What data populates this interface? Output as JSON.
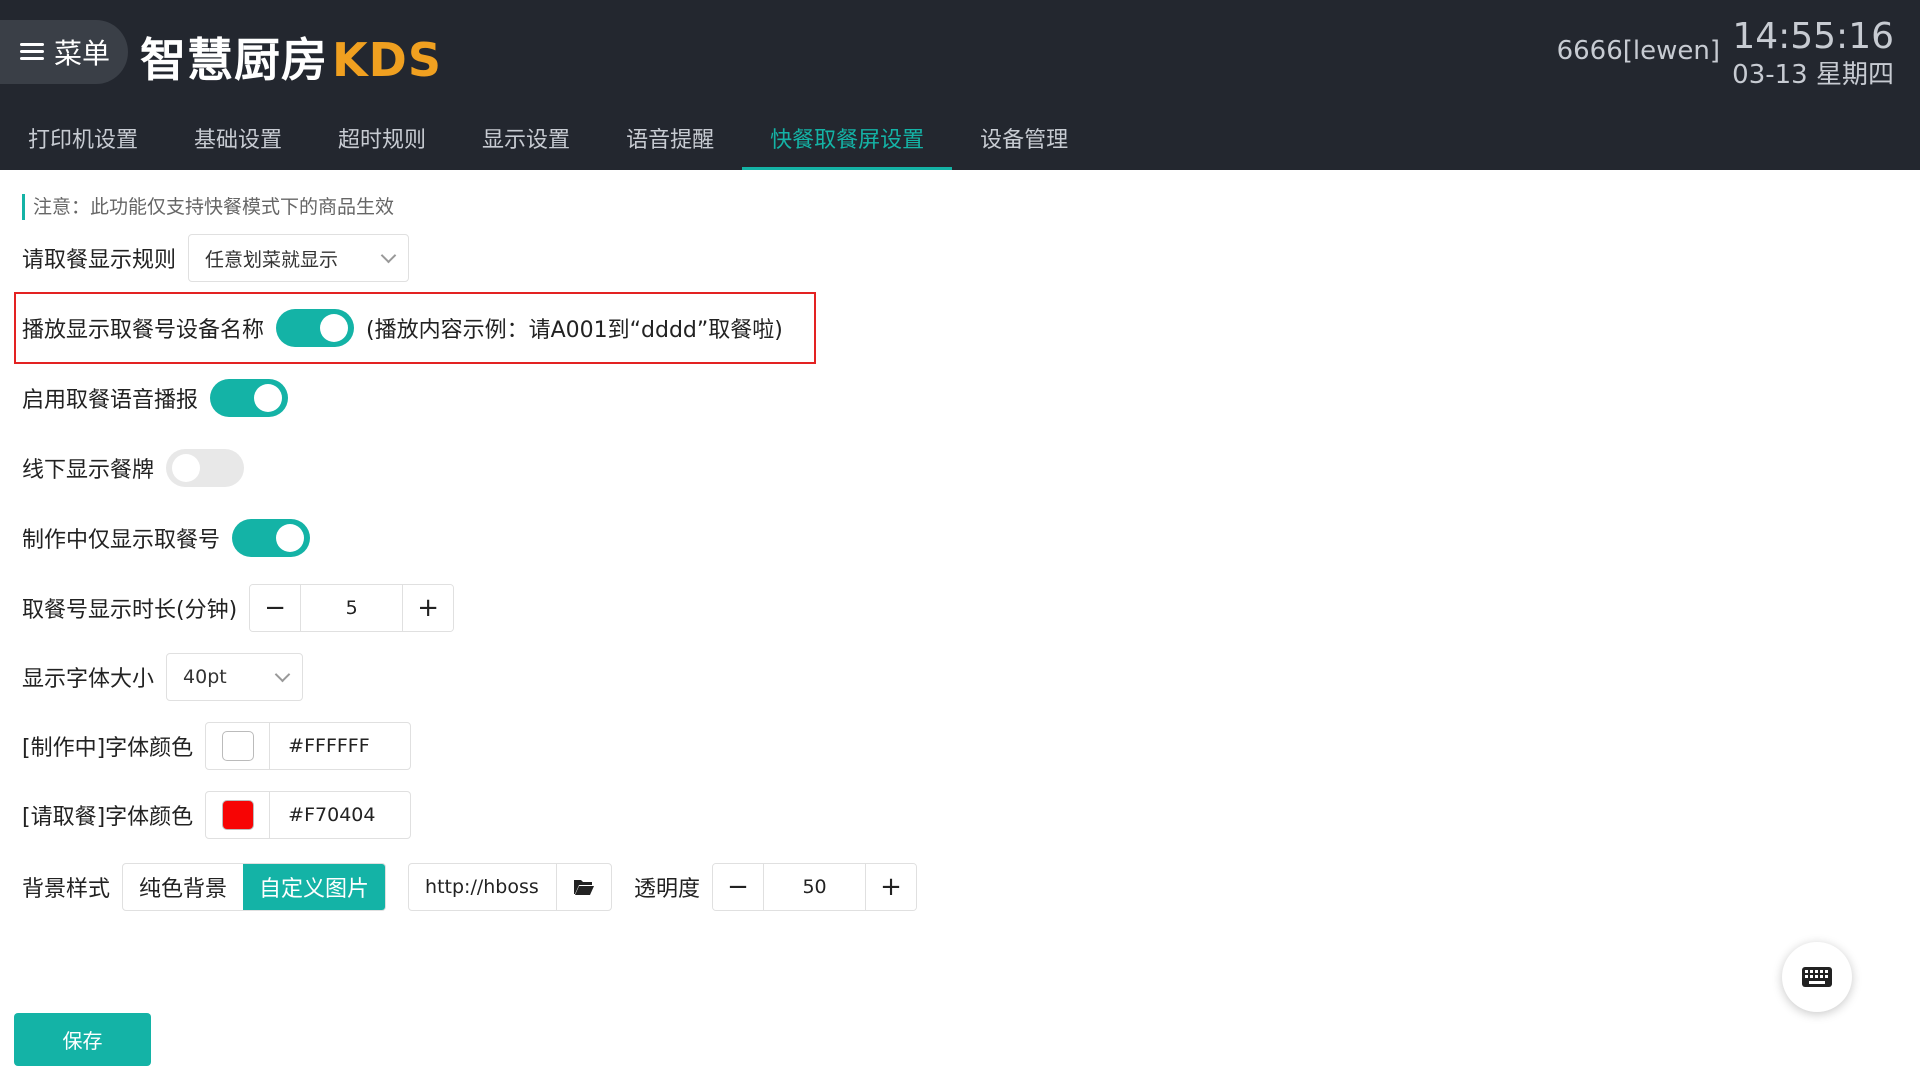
{
  "header": {
    "menu_label": "菜单",
    "logo_cn": "智慧厨房",
    "logo_kds": "KDS",
    "user": "6666[lewen]",
    "time": "14:55:16",
    "date": "03-13 星期四"
  },
  "tabs": [
    {
      "label": "打印机设置",
      "active": false
    },
    {
      "label": "基础设置",
      "active": false
    },
    {
      "label": "超时规则",
      "active": false
    },
    {
      "label": "显示设置",
      "active": false
    },
    {
      "label": "语音提醒",
      "active": false
    },
    {
      "label": "快餐取餐屏设置",
      "active": true
    },
    {
      "label": "设备管理",
      "active": false
    }
  ],
  "notice": "注意：此功能仅支持快餐模式下的商品生效",
  "settings": {
    "pickup_rule": {
      "label": "请取餐显示规则",
      "value": "任意划菜就显示"
    },
    "play_device_name": {
      "label": "播放显示取餐号设备名称",
      "on": true,
      "hint": "(播放内容示例：请A001到“dddd”取餐啦)"
    },
    "voice_broadcast": {
      "label": "启用取餐语音播报",
      "on": true
    },
    "offline_plate": {
      "label": "线下显示餐牌",
      "on": false
    },
    "making_only_number": {
      "label": "制作中仅显示取餐号",
      "on": true
    },
    "display_duration": {
      "label": "取餐号显示时长(分钟)",
      "value": "5"
    },
    "font_size": {
      "label": "显示字体大小",
      "value": "40pt"
    },
    "making_color": {
      "label": "[制作中]字体颜色",
      "hex": "#FFFFFF"
    },
    "pickup_color": {
      "label": "[请取餐]字体颜色",
      "hex": "#F70404"
    },
    "background": {
      "label": "背景样式",
      "options": [
        "纯色背景",
        "自定义图片"
      ],
      "selected": "自定义图片",
      "url": "http://hboss",
      "opacity_label": "透明度",
      "opacity": "50"
    }
  },
  "icons": {
    "minus": "−",
    "plus": "+",
    "folder": "folder-open-icon",
    "keyboard": "keyboard-icon"
  },
  "save_label": "保存",
  "colors": {
    "accent": "#14b3a6",
    "header_bg": "#23272f",
    "logo_kds": "#f0a020",
    "highlight": "#e32222"
  }
}
